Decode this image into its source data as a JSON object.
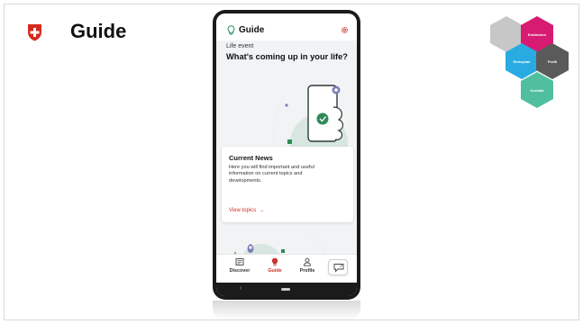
{
  "slide": {
    "title": "Guide"
  },
  "hex_cluster": {
    "items": [
      {
        "label": "",
        "color": "#c7c7c7"
      },
      {
        "label": "Entdecken",
        "color": "#d81b72"
      },
      {
        "label": "Reiseplan",
        "color": "#29abe2"
      },
      {
        "label": "Profil",
        "color": "#5a5a5a"
      },
      {
        "label": "Kontakt",
        "color": "#4fbf9f"
      }
    ]
  },
  "app": {
    "header": {
      "title": "Guide",
      "icon": "lightbulb-icon",
      "settings_icon": "gear-icon"
    },
    "section_label": "Life event",
    "headline": "What's coming up in your life?",
    "news_card": {
      "title": "Current News",
      "text": "Here you will find important and useful information on current topics and developments.",
      "link": "View topics",
      "link_arrow": "→"
    },
    "bottom_nav": {
      "items": [
        {
          "label": "Discover",
          "icon": "newspaper-icon",
          "active": false
        },
        {
          "label": "Guide",
          "icon": "lightbulb-icon",
          "active": true
        },
        {
          "label": "Profile",
          "icon": "person-icon",
          "active": false
        }
      ],
      "feedback_icon": "feedback-icon"
    },
    "system_bar": {
      "back": "‹"
    }
  },
  "colors": {
    "accent": "#c8332b",
    "illustration_green": "#2e8b57",
    "illustration_light": "#cfe3dc",
    "background": "#f1f3f5"
  }
}
